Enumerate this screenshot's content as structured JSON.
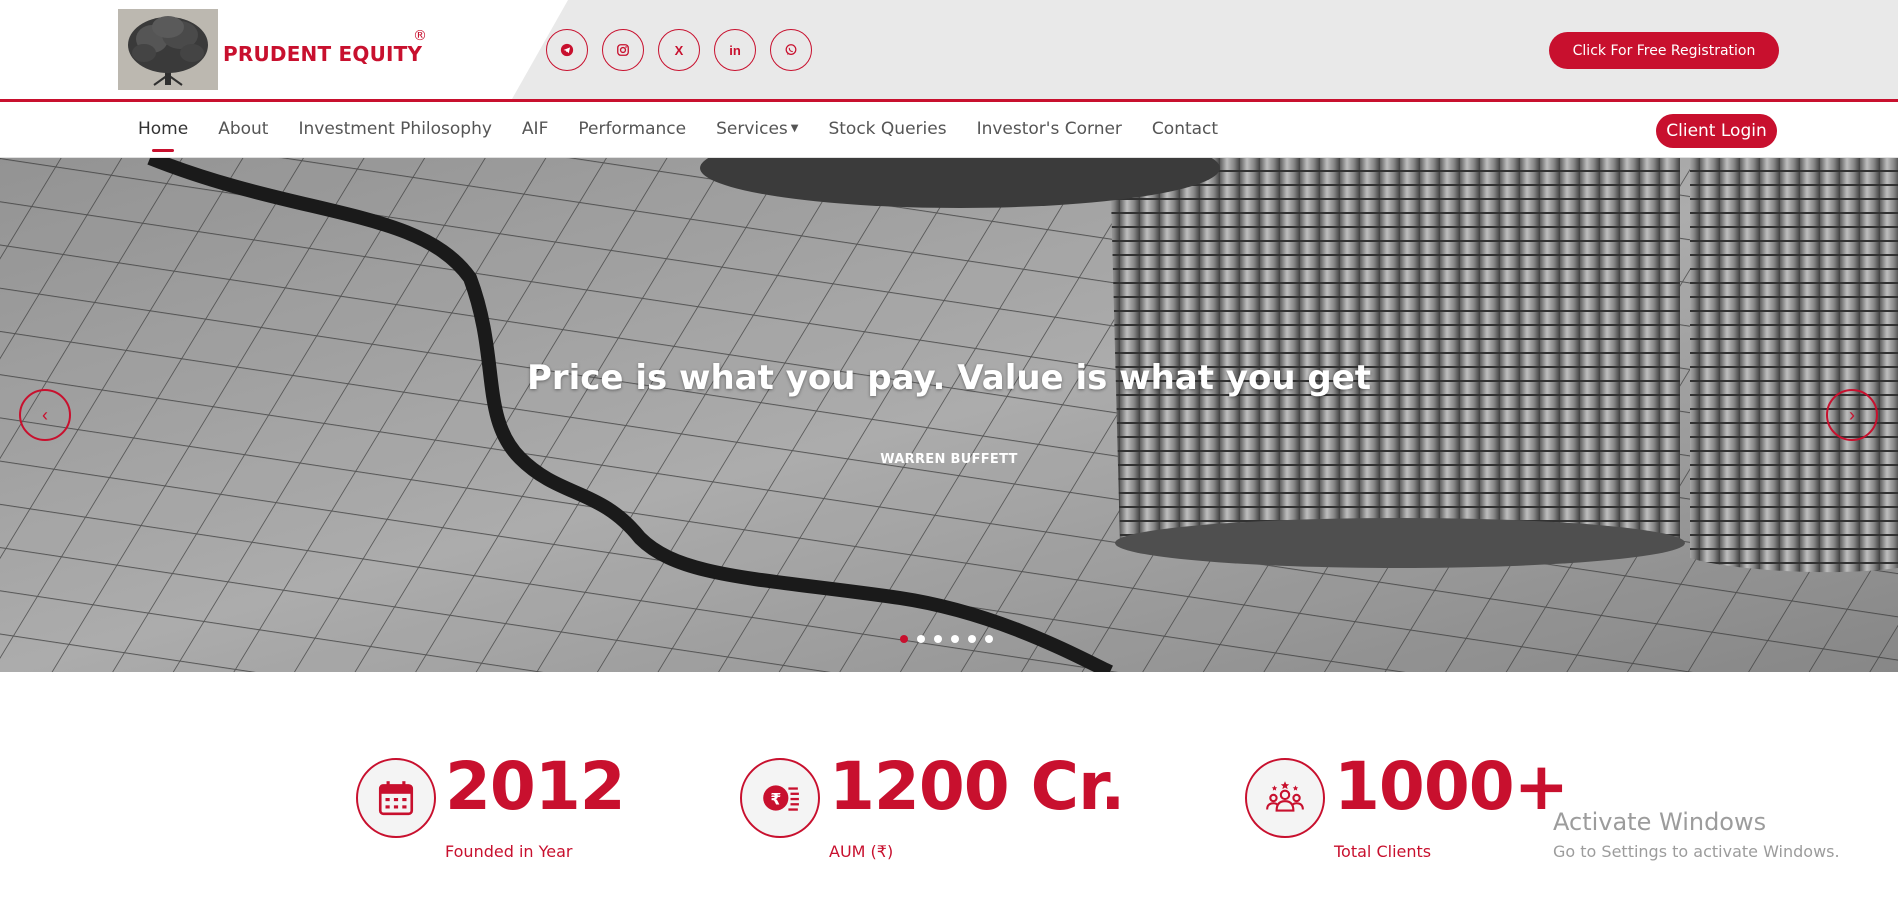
{
  "header": {
    "brand_name": "PRUDENT EQUITY",
    "brand_mark": "®",
    "socials": [
      {
        "name": "telegram-icon"
      },
      {
        "name": "instagram-icon"
      },
      {
        "name": "x-icon",
        "label": "X"
      },
      {
        "name": "linkedin-icon",
        "label": "in"
      },
      {
        "name": "whatsapp-icon"
      }
    ],
    "register_label": "Click For Free Registration"
  },
  "nav": {
    "items": [
      {
        "label": "Home",
        "active": true
      },
      {
        "label": "About"
      },
      {
        "label": "Investment Philosophy"
      },
      {
        "label": "AIF"
      },
      {
        "label": "Performance"
      },
      {
        "label": "Services"
      },
      {
        "label": "Stock Queries"
      },
      {
        "label": "Investor's Corner"
      },
      {
        "label": "Contact"
      }
    ],
    "login_label": "Client Login"
  },
  "hero": {
    "quote": "Price is what you pay. Value is what you get",
    "author": "WARREN BUFFETT",
    "slide_count": 6,
    "active_slide": 1,
    "prev_icon": "chevron-left-icon",
    "next_icon": "chevron-right-icon"
  },
  "stats": [
    {
      "value": "2012",
      "label": "Founded in Year",
      "icon": "calendar-icon"
    },
    {
      "value": "1200 Cr.",
      "label": "AUM (₹)",
      "icon": "rupee-coins-icon"
    },
    {
      "value": "1000+",
      "label": "Total Clients",
      "icon": "clients-group-icon"
    }
  ],
  "watermark": {
    "title": "Activate Windows",
    "subtitle": "Go to Settings to activate Windows."
  },
  "colors": {
    "accent": "#c8102e",
    "header_grey": "#e9e9e9"
  }
}
